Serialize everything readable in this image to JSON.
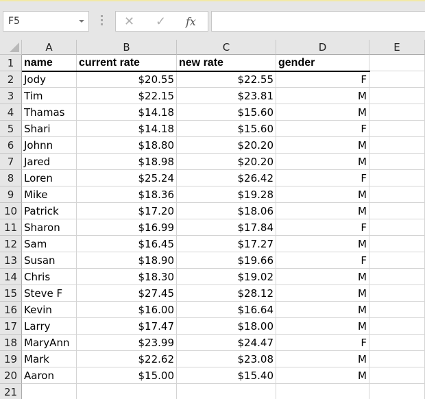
{
  "formula_bar": {
    "name_box": "F5",
    "cancel_icon": "✕",
    "enter_icon": "✓",
    "function_icon": "fx",
    "formula": ""
  },
  "columns": [
    "A",
    "B",
    "C",
    "D",
    "E"
  ],
  "row_numbers": [
    "1",
    "2",
    "3",
    "4",
    "5",
    "6",
    "7",
    "8",
    "9",
    "10",
    "11",
    "12",
    "13",
    "14",
    "15",
    "16",
    "17",
    "18",
    "19",
    "20",
    "21"
  ],
  "table": {
    "headers": [
      "name",
      "current rate",
      "new rate",
      "gender"
    ],
    "rows": [
      [
        "Jody",
        "$20.55",
        "$22.55",
        "F"
      ],
      [
        "Tim",
        "$22.15",
        "$23.81",
        "M"
      ],
      [
        "Thamas",
        "$14.18",
        "$15.60",
        "M"
      ],
      [
        "Shari",
        "$14.18",
        "$15.60",
        "F"
      ],
      [
        "Johnn",
        "$18.80",
        "$20.20",
        "M"
      ],
      [
        "Jared",
        "$18.98",
        "$20.20",
        "M"
      ],
      [
        "Loren",
        "$25.24",
        "$26.42",
        "F"
      ],
      [
        "Mike",
        "$18.36",
        "$19.28",
        "M"
      ],
      [
        "Patrick",
        "$17.20",
        "$18.06",
        "M"
      ],
      [
        "Sharon",
        "$16.99",
        "$17.84",
        "F"
      ],
      [
        "Sam",
        "$16.45",
        "$17.27",
        "M"
      ],
      [
        "Susan",
        "$18.90",
        "$19.66",
        "F"
      ],
      [
        "Chris",
        "$18.30",
        "$19.02",
        "M"
      ],
      [
        "Steve F",
        "$27.45",
        "$28.12",
        "M"
      ],
      [
        "Kevin",
        "$16.00",
        "$16.64",
        "M"
      ],
      [
        "Larry",
        "$17.47",
        "$18.00",
        "M"
      ],
      [
        "MaryAnn",
        "$23.99",
        "$24.47",
        "F"
      ],
      [
        "Mark",
        "$22.62",
        "$23.08",
        "M"
      ],
      [
        "Aaron",
        "$15.00",
        "$15.40",
        "M "
      ]
    ]
  }
}
